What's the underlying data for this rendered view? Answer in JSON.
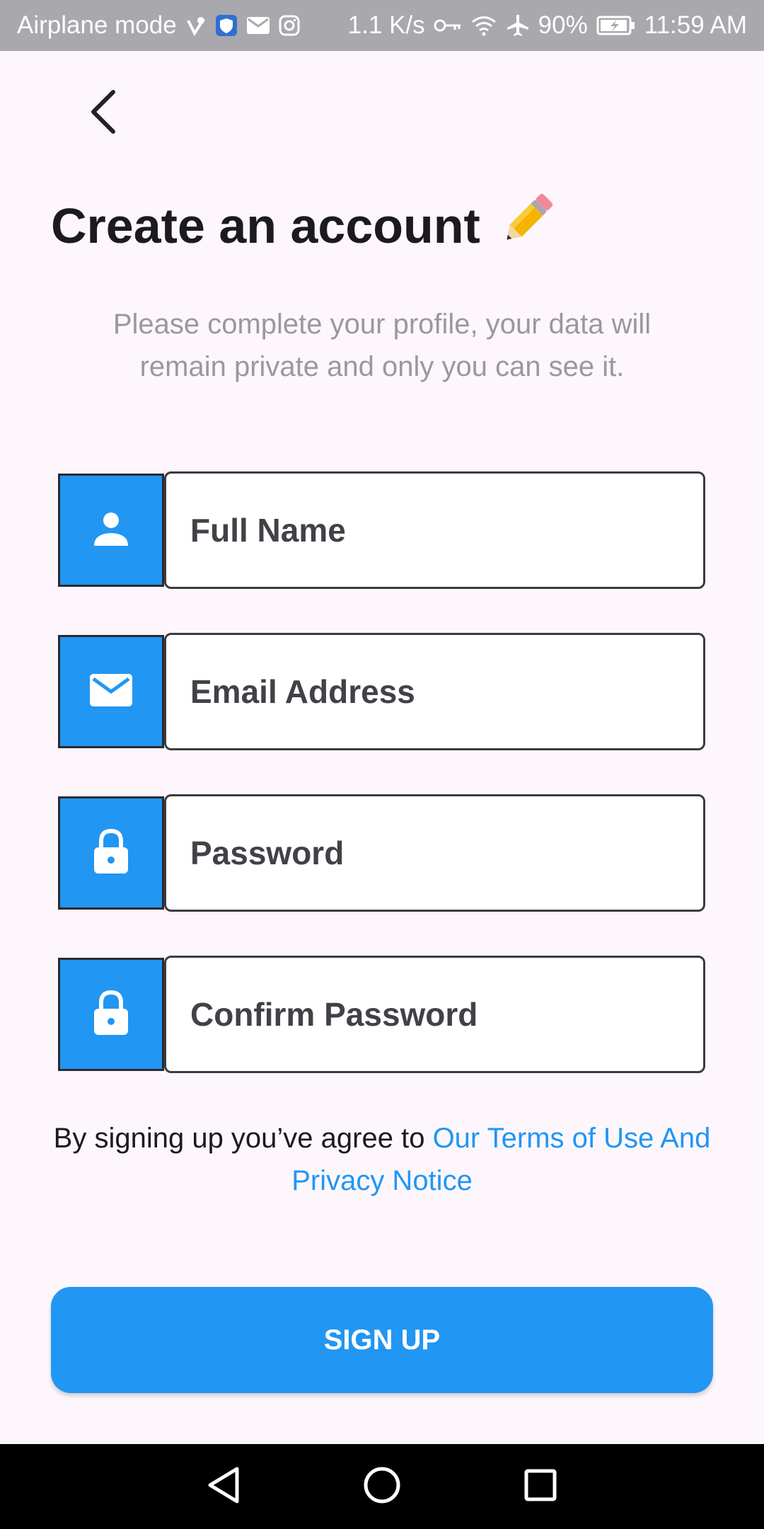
{
  "status_bar": {
    "left_text": "Airplane mode",
    "speed": "1.1 K/s",
    "battery": "90%",
    "time": "11:59 AM",
    "icons": [
      "check-heart-icon",
      "shield-icon",
      "mail-icon",
      "instagram-icon",
      "key-icon",
      "wifi-icon",
      "airplane-icon",
      "battery-icon"
    ]
  },
  "header": {
    "back_icon": "back-arrow-icon",
    "title": "Create an account",
    "title_icon": "pencil-icon"
  },
  "subtitle": "Please complete your profile, your data will remain private and only you can see it.",
  "form": {
    "fields": [
      {
        "icon": "person-icon",
        "placeholder": "Full Name"
      },
      {
        "icon": "mail-icon",
        "placeholder": "Email Address"
      },
      {
        "icon": "lock-icon",
        "placeholder": "Password"
      },
      {
        "icon": "lock-icon",
        "placeholder": "Confirm Password"
      }
    ]
  },
  "terms": {
    "prefix": "By signing up you’ve agree to ",
    "link": "Our Terms of Use And Privacy Notice"
  },
  "signup_button": "SIGN UP",
  "colors": {
    "accent": "#2196f3",
    "background": "#fdf7fd",
    "status_bar": "#a9a8ac",
    "nav_bar": "#000000"
  },
  "nav": {
    "icons": [
      "back-triangle-icon",
      "home-circle-icon",
      "recents-square-icon"
    ]
  }
}
